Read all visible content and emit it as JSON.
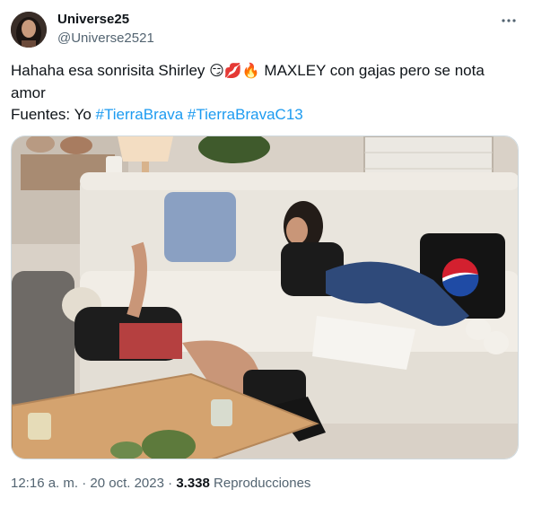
{
  "author": {
    "display_name": "Universe25",
    "handle": "@Universe2521"
  },
  "tweet": {
    "line1_text": "Hahaha esa sonrisita Shirley",
    "line1_emojis": [
      "😏",
      "💋",
      "🔥"
    ],
    "line1_after": "MAXLEY con gajas pero se nota",
    "line2_text": "amor",
    "line3_prefix": "Fuentes: Yo",
    "hashtags": [
      "#TierraBrava",
      "#TierraBravaC13"
    ]
  },
  "media": {
    "description_icons": [
      "pillow",
      "sofa",
      "pepsi-logo",
      "mug",
      "plant"
    ],
    "pillow_brand": "pepsi"
  },
  "meta": {
    "time": "12:16 a. m.",
    "separator": "·",
    "date": "20 oct. 2023",
    "views_count": "3.338",
    "views_label": "Reproducciones"
  },
  "icons": {
    "more": "more-options-icon"
  },
  "colors": {
    "link": "#1d9bf0",
    "secondary_text": "#536471",
    "primary_text": "#0f1419",
    "border": "#cfd9de"
  }
}
